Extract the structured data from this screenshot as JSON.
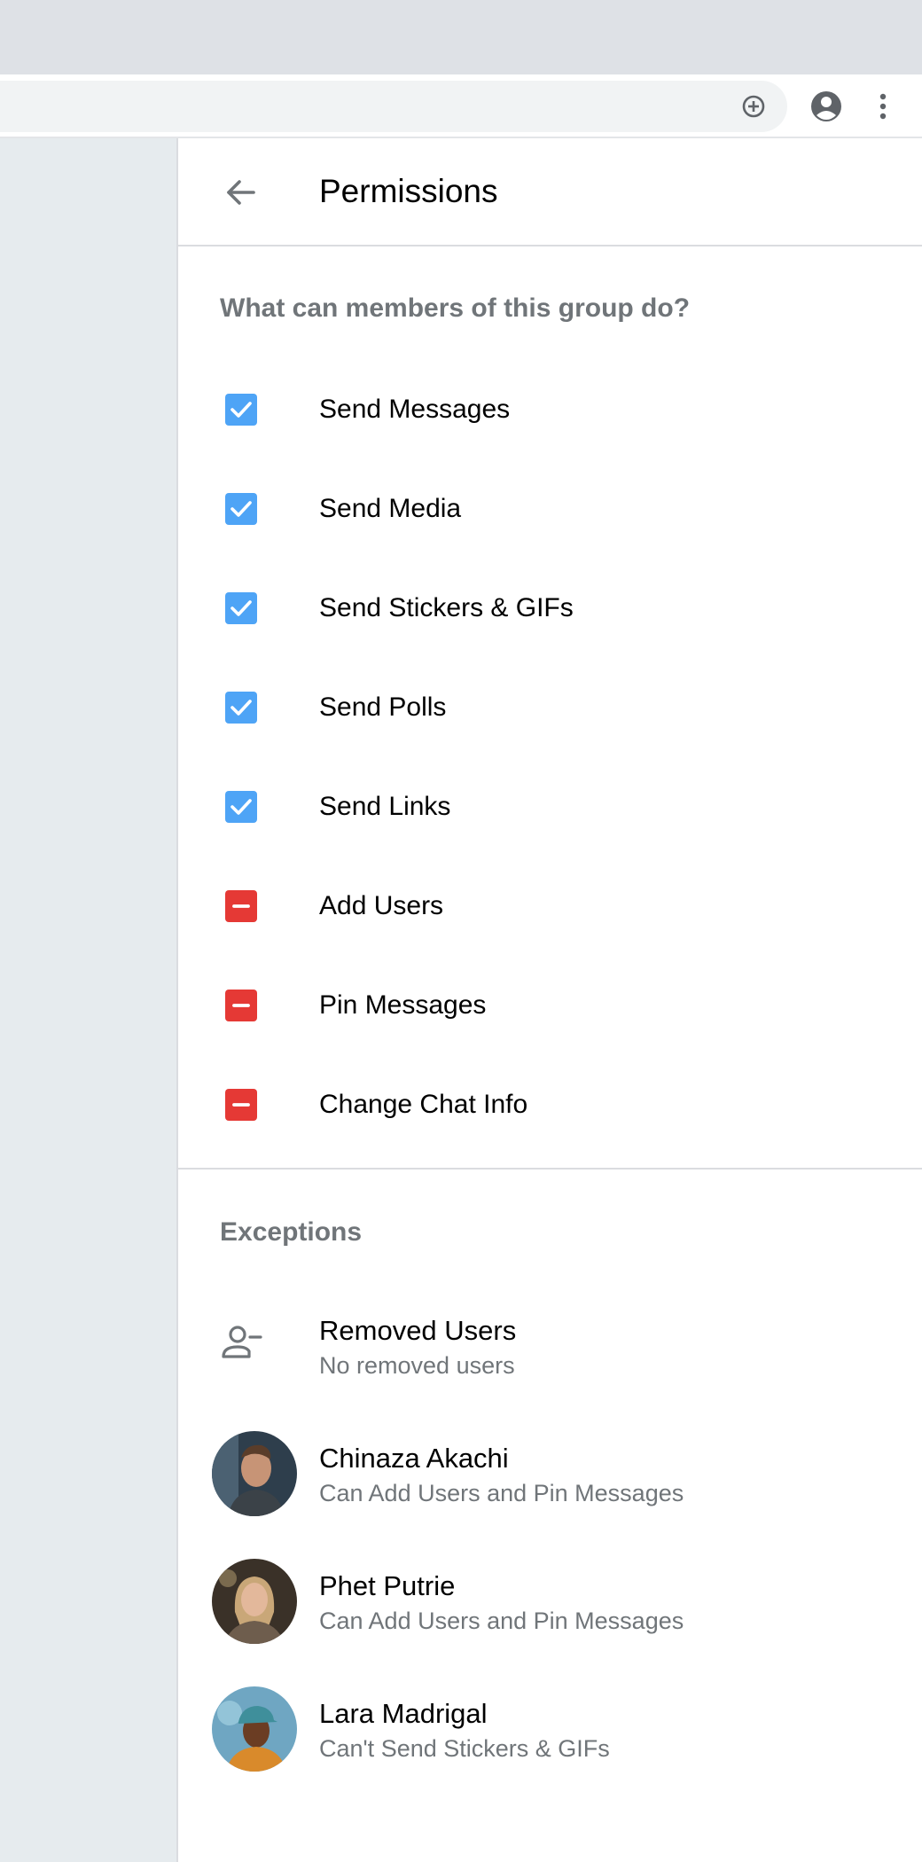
{
  "browser": {
    "icons": {
      "zoom": "add-circle-icon",
      "profile": "account-circle-icon",
      "menu": "more-vert-icon"
    }
  },
  "header": {
    "title": "Permissions",
    "back_icon": "arrow-left-icon"
  },
  "permissions": {
    "heading": "What can members of this group do?",
    "items": [
      {
        "label": "Send Messages",
        "enabled": true
      },
      {
        "label": "Send Media",
        "enabled": true
      },
      {
        "label": "Send Stickers & GIFs",
        "enabled": true
      },
      {
        "label": "Send Polls",
        "enabled": true
      },
      {
        "label": "Send Links",
        "enabled": true
      },
      {
        "label": "Add Users",
        "enabled": false
      },
      {
        "label": "Pin Messages",
        "enabled": false
      },
      {
        "label": "Change Chat Info",
        "enabled": false
      }
    ]
  },
  "exceptions": {
    "heading": "Exceptions",
    "removed": {
      "title": "Removed Users",
      "subtitle": "No removed users",
      "icon": "user-remove-icon"
    },
    "members": [
      {
        "name": "Chinaza Akachi",
        "detail": "Can Add Users and Pin Messages"
      },
      {
        "name": "Phet Putrie",
        "detail": "Can Add Users and Pin Messages"
      },
      {
        "name": "Lara Madrigal",
        "detail": "Can't Send Stickers & GIFs"
      }
    ]
  },
  "colors": {
    "accent": "#4ea4f6",
    "danger": "#e53935",
    "secondary_text": "#707579",
    "left_pane": "#e6ebee"
  }
}
